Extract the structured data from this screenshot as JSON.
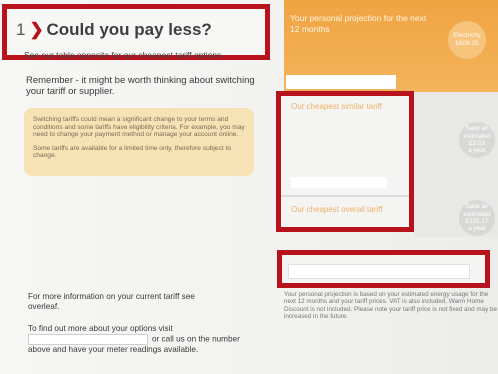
{
  "section": {
    "number": "1",
    "heading": "Could you pay less?",
    "subheading": "See our table opposite for our cheapest tariff options."
  },
  "remember_text": "Remember - it might be worth thinking about switching your tariff or supplier.",
  "note_card": {
    "paragraph1": "Switching tariffs could mean a significant change to your terms and conditions and some tariffs have eligibility criteria. For example, you may need to change your payment method or manage your account online.",
    "paragraph2": "Some tariffs are available for a limited time only, therefore subject to change."
  },
  "more_info": "For more information on your current tariff see overleaf.",
  "find_out": {
    "line1": "To find out more about your options visit",
    "line2": "or call us on the number",
    "line3": "above and have your meter readings available."
  },
  "projection_panel": {
    "title": "Your personal projection for the next 12 months",
    "badge_label": "Electricity",
    "badge_value": "£808.25"
  },
  "similar_tariff": {
    "label": "Our cheapest similar tariff",
    "save_line1": "Save an",
    "save_line2": "estimated",
    "save_value": "£2.03",
    "save_period": "a year"
  },
  "overall_tariff": {
    "label": "Our cheapest overall tariff",
    "save_line1": "Save an",
    "save_line2": "estimated",
    "save_value": "£131.17",
    "save_period": "a year"
  },
  "projection_note": "Your personal projection is based on your estimated energy usage for the next 12 months and your tariff prices. VAT is also included, Warm Home Discount is not included. Please note your tariff price is not fixed and may be increased in the future.",
  "colors": {
    "highlight_border": "#b8121c",
    "orange_panel": "#f0a443",
    "note_card": "#f7e2b6"
  }
}
